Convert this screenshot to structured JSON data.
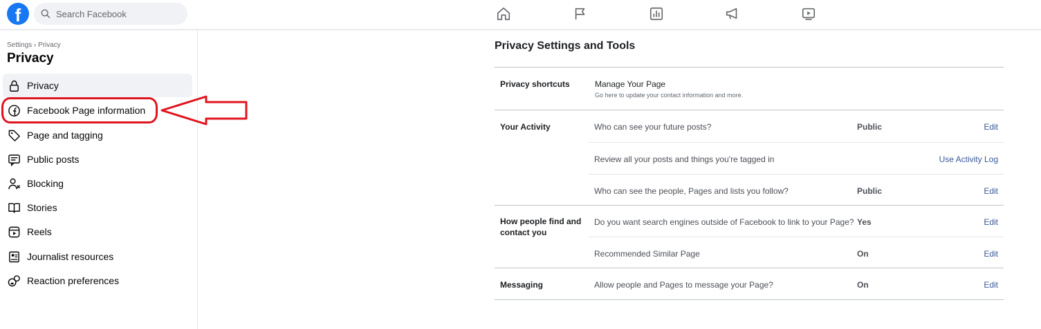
{
  "topbar": {
    "logo_letter": "f",
    "search_placeholder": "Search Facebook",
    "nav_icons": [
      "home-icon",
      "flag-icon",
      "insights-icon",
      "megaphone-icon",
      "video-icon"
    ]
  },
  "sidebar": {
    "breadcrumb": "Settings › Privacy",
    "title": "Privacy",
    "items": [
      {
        "label": "Privacy",
        "icon": "lock-icon"
      },
      {
        "label": "Facebook Page information",
        "icon": "facebook-icon"
      },
      {
        "label": "Page and tagging",
        "icon": "tag-icon"
      },
      {
        "label": "Public posts",
        "icon": "public-posts-icon"
      },
      {
        "label": "Blocking",
        "icon": "blocking-icon"
      },
      {
        "label": "Stories",
        "icon": "stories-icon"
      },
      {
        "label": "Reels",
        "icon": "reels-icon"
      },
      {
        "label": "Journalist resources",
        "icon": "journalist-icon"
      },
      {
        "label": "Reaction preferences",
        "icon": "reaction-icon"
      }
    ]
  },
  "annotation": {
    "color": "#e0141e"
  },
  "main": {
    "title": "Privacy Settings and Tools",
    "shortcuts": {
      "label": "Privacy shortcuts",
      "link_title": "Manage Your Page",
      "link_desc": "Go here to update your contact information and more."
    },
    "activity": {
      "label": "Your Activity",
      "rows": [
        {
          "question": "Who can see your future posts?",
          "value": "Public",
          "action": "Edit"
        },
        {
          "question": "Review all your posts and things you're tagged in",
          "value": "",
          "action": "Use Activity Log"
        },
        {
          "question": "Who can see the people, Pages and lists you follow?",
          "value": "Public",
          "action": "Edit"
        }
      ]
    },
    "find": {
      "label": "How people find and contact you",
      "rows": [
        {
          "question": "Do you want search engines outside of Facebook to link to your Page?",
          "value": "Yes",
          "action": "Edit"
        },
        {
          "question": "Recommended Similar Page",
          "value": "On",
          "action": "Edit"
        }
      ]
    },
    "messaging": {
      "label": "Messaging",
      "rows": [
        {
          "question": "Allow people and Pages to message your Page?",
          "value": "On",
          "action": "Edit"
        }
      ]
    }
  },
  "colors": {
    "brand": "#1877f2",
    "link": "#385898",
    "annotation": "#e0141e"
  }
}
